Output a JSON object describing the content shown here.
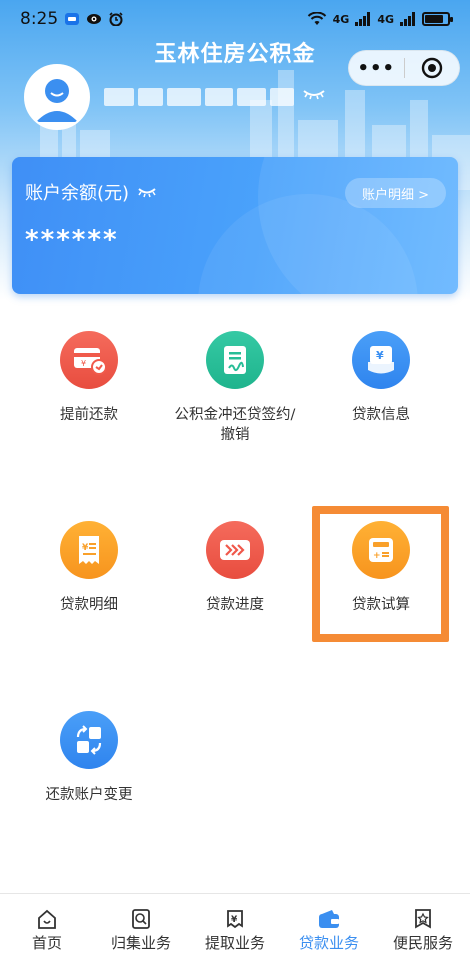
{
  "status_bar": {
    "time": "8:25",
    "network1": "4G",
    "network2": "4G"
  },
  "app": {
    "title": "玉林住房公积金",
    "more_label": "•••"
  },
  "account": {
    "balance_label": "账户余额(元)",
    "balance_value": "******",
    "detail_button": "账户明细 >"
  },
  "menu": [
    {
      "label": "提前还款",
      "icon": "early-repay-icon",
      "color": "#f0584b"
    },
    {
      "label": "公积金冲还贷签约/撤销",
      "icon": "contract-icon",
      "color": "#27bd97"
    },
    {
      "label": "贷款信息",
      "icon": "loan-info-icon",
      "color": "#3a8ff2"
    },
    {
      "label": "贷款明细",
      "icon": "receipt-icon",
      "color": "#f9a02a"
    },
    {
      "label": "贷款进度",
      "icon": "progress-icon",
      "color": "#f0584b"
    },
    {
      "label": "贷款试算",
      "icon": "calculator-icon",
      "color": "#f9a02a"
    },
    {
      "label": "还款账户变更",
      "icon": "account-change-icon",
      "color": "#3a8ff2"
    }
  ],
  "highlight_color": "#f58b35",
  "tabbar": [
    {
      "label": "首页",
      "icon": "home-icon",
      "active": false
    },
    {
      "label": "归集业务",
      "icon": "search-doc-icon",
      "active": false
    },
    {
      "label": "提取业务",
      "icon": "withdraw-icon",
      "active": false
    },
    {
      "label": "贷款业务",
      "icon": "wallet-icon",
      "active": true
    },
    {
      "label": "便民服务",
      "icon": "star-badge-icon",
      "active": false
    }
  ],
  "colors": {
    "accent": "#3b8ff0",
    "card": "#4a9df8"
  }
}
